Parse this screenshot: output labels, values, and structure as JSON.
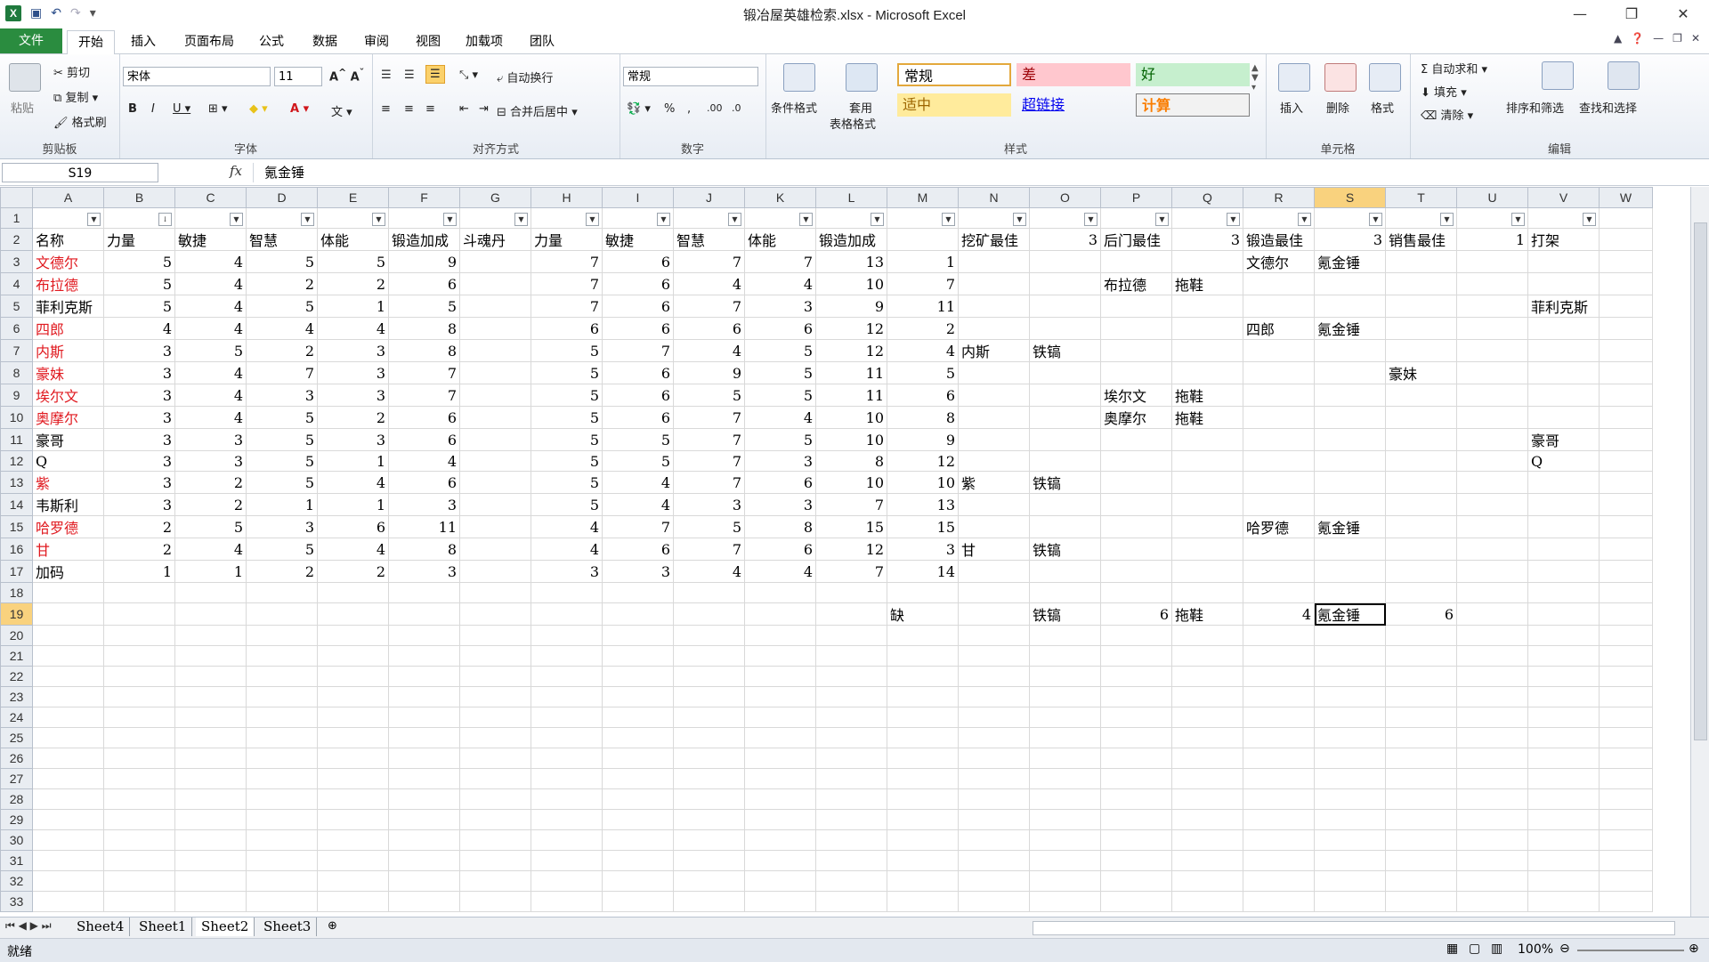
{
  "window": {
    "title": "锻冶屋英雄检索.xlsx - Microsoft Excel"
  },
  "ribbon_tabs": [
    "文件",
    "开始",
    "插入",
    "页面布局",
    "公式",
    "数据",
    "审阅",
    "视图",
    "加载项",
    "团队"
  ],
  "clipboard": {
    "paste": "粘贴",
    "cut": "剪切",
    "copy": "复制",
    "format_painter": "格式刷",
    "label": "剪贴板"
  },
  "font": {
    "name": "宋体",
    "size": "11",
    "label": "字体"
  },
  "alignment": {
    "wrap": "自动换行",
    "merge": "合并后居中",
    "label": "对齐方式"
  },
  "number": {
    "format": "常规",
    "label": "数字"
  },
  "styles": {
    "cond": "条件格式",
    "table1": "套用",
    "table2": "表格格式",
    "normal": "常规",
    "bad": "差",
    "good": "好",
    "neutral": "适中",
    "hyperlink": "超链接",
    "calc": "计算",
    "label": "样式"
  },
  "cells": {
    "insert": "插入",
    "delete": "删除",
    "format": "格式",
    "label": "单元格"
  },
  "editing": {
    "autosum": "自动求和",
    "fill": "填充",
    "clear": "清除",
    "sort": "排序和筛选",
    "find": "查找和选择",
    "label": "编辑"
  },
  "formula_bar": {
    "name_box": "S19",
    "content": "氪金锤"
  },
  "columns": [
    "A",
    "B",
    "C",
    "D",
    "E",
    "F",
    "G",
    "H",
    "I",
    "J",
    "K",
    "L",
    "M",
    "N",
    "O",
    "P",
    "Q",
    "R",
    "S",
    "T",
    "U",
    "V",
    "W"
  ],
  "filter_row_b": "↓",
  "rows": [
    {
      "n": "1",
      "c": [
        "",
        "",
        "",
        "",
        "",
        "",
        "",
        "",
        "",
        "",
        "",
        "",
        "",
        "",
        "",
        "",
        "",
        "",
        "",
        "",
        "",
        "",
        ""
      ]
    },
    {
      "n": "2",
      "c": [
        "名称",
        "力量",
        "敏捷",
        "智慧",
        "体能",
        "锻造加成",
        "斗魂丹",
        "力量",
        "敏捷",
        "智慧",
        "体能",
        "锻造加成",
        "",
        "挖矿最佳",
        "3",
        "后门最佳",
        "3",
        "锻造最佳",
        "3",
        "销售最佳",
        "1",
        "打架",
        ""
      ]
    },
    {
      "n": "3",
      "c": [
        "文德尔",
        "5",
        "4",
        "5",
        "5",
        "9",
        "",
        "7",
        "6",
        "7",
        "7",
        "13",
        "1",
        "",
        "",
        "",
        "",
        "文德尔",
        "氪金锤",
        "",
        "",
        "",
        ""
      ]
    },
    {
      "n": "4",
      "c": [
        "布拉德",
        "5",
        "4",
        "2",
        "2",
        "6",
        "",
        "7",
        "6",
        "4",
        "4",
        "10",
        "7",
        "",
        "",
        "布拉德",
        "拖鞋",
        "",
        "",
        "",
        "",
        "",
        ""
      ]
    },
    {
      "n": "5",
      "c": [
        "菲利克斯",
        "5",
        "4",
        "5",
        "1",
        "5",
        "",
        "7",
        "6",
        "7",
        "3",
        "9",
        "11",
        "",
        "",
        "",
        "",
        "",
        "",
        "",
        "",
        "菲利克斯",
        ""
      ]
    },
    {
      "n": "6",
      "c": [
        "四郎",
        "4",
        "4",
        "4",
        "4",
        "8",
        "",
        "6",
        "6",
        "6",
        "6",
        "12",
        "2",
        "",
        "",
        "",
        "",
        "四郎",
        "氪金锤",
        "",
        "",
        "",
        ""
      ]
    },
    {
      "n": "7",
      "c": [
        "内斯",
        "3",
        "5",
        "2",
        "3",
        "8",
        "",
        "5",
        "7",
        "4",
        "5",
        "12",
        "4",
        "内斯",
        "铁镐",
        "",
        "",
        "",
        "",
        "",
        "",
        "",
        ""
      ]
    },
    {
      "n": "8",
      "c": [
        "豪妹",
        "3",
        "4",
        "7",
        "3",
        "7",
        "",
        "5",
        "6",
        "9",
        "5",
        "11",
        "5",
        "",
        "",
        "",
        "",
        "",
        "",
        "豪妹",
        "",
        "",
        ""
      ]
    },
    {
      "n": "9",
      "c": [
        "埃尔文",
        "3",
        "4",
        "3",
        "3",
        "7",
        "",
        "5",
        "6",
        "5",
        "5",
        "11",
        "6",
        "",
        "",
        "埃尔文",
        "拖鞋",
        "",
        "",
        "",
        "",
        "",
        ""
      ]
    },
    {
      "n": "10",
      "c": [
        "奥摩尔",
        "3",
        "4",
        "5",
        "2",
        "6",
        "",
        "5",
        "6",
        "7",
        "4",
        "10",
        "8",
        "",
        "",
        "奥摩尔",
        "拖鞋",
        "",
        "",
        "",
        "",
        "",
        ""
      ]
    },
    {
      "n": "11",
      "c": [
        "豪哥",
        "3",
        "3",
        "5",
        "3",
        "6",
        "",
        "5",
        "5",
        "7",
        "5",
        "10",
        "9",
        "",
        "",
        "",
        "",
        "",
        "",
        "",
        "",
        "豪哥",
        ""
      ]
    },
    {
      "n": "12",
      "c": [
        "Q",
        "3",
        "3",
        "5",
        "1",
        "4",
        "",
        "5",
        "5",
        "7",
        "3",
        "8",
        "12",
        "",
        "",
        "",
        "",
        "",
        "",
        "",
        "",
        "Q",
        ""
      ]
    },
    {
      "n": "13",
      "c": [
        "紫",
        "3",
        "2",
        "5",
        "4",
        "6",
        "",
        "5",
        "4",
        "7",
        "6",
        "10",
        "10",
        "紫",
        "铁镐",
        "",
        "",
        "",
        "",
        "",
        "",
        "",
        ""
      ]
    },
    {
      "n": "14",
      "c": [
        "韦斯利",
        "3",
        "2",
        "1",
        "1",
        "3",
        "",
        "5",
        "4",
        "3",
        "3",
        "7",
        "13",
        "",
        "",
        "",
        "",
        "",
        "",
        "",
        "",
        "",
        ""
      ]
    },
    {
      "n": "15",
      "c": [
        "哈罗德",
        "2",
        "5",
        "3",
        "6",
        "11",
        "",
        "4",
        "7",
        "5",
        "8",
        "15",
        "15",
        "",
        "",
        "",
        "",
        "哈罗德",
        "氪金锤",
        "",
        "",
        "",
        ""
      ]
    },
    {
      "n": "16",
      "c": [
        "甘",
        "2",
        "4",
        "5",
        "4",
        "8",
        "",
        "4",
        "6",
        "7",
        "6",
        "12",
        "3",
        "甘",
        "铁镐",
        "",
        "",
        "",
        "",
        "",
        "",
        "",
        ""
      ]
    },
    {
      "n": "17",
      "c": [
        "加码",
        "1",
        "1",
        "2",
        "2",
        "3",
        "",
        "3",
        "3",
        "4",
        "4",
        "7",
        "14",
        "",
        "",
        "",
        "",
        "",
        "",
        "",
        "",
        "",
        ""
      ]
    },
    {
      "n": "18",
      "c": [
        "",
        "",
        "",
        "",
        "",
        "",
        "",
        "",
        "",
        "",
        "",
        "",
        "",
        "",
        "",
        "",
        "",
        "",
        "",
        "",
        "",
        "",
        ""
      ]
    },
    {
      "n": "19",
      "c": [
        "",
        "",
        "",
        "",
        "",
        "",
        "",
        "",
        "",
        "",
        "",
        "",
        "缺",
        "",
        "铁镐",
        "6",
        "拖鞋",
        "4",
        "氪金锤",
        "6",
        "",
        "",
        ""
      ]
    },
    {
      "n": "20",
      "c": []
    },
    {
      "n": "21",
      "c": []
    },
    {
      "n": "22",
      "c": []
    },
    {
      "n": "23",
      "c": []
    },
    {
      "n": "24",
      "c": []
    },
    {
      "n": "25",
      "c": []
    },
    {
      "n": "26",
      "c": []
    },
    {
      "n": "27",
      "c": []
    },
    {
      "n": "28",
      "c": []
    },
    {
      "n": "29",
      "c": []
    },
    {
      "n": "30",
      "c": []
    },
    {
      "n": "31",
      "c": []
    },
    {
      "n": "32",
      "c": []
    },
    {
      "n": "33",
      "c": []
    }
  ],
  "red_names": [
    "文德尔",
    "布拉德",
    "四郎",
    "内斯",
    "豪妹",
    "埃尔文",
    "奥摩尔",
    "紫",
    "哈罗德",
    "甘"
  ],
  "sheets": [
    "Sheet4",
    "Sheet1",
    "Sheet2",
    "Sheet3"
  ],
  "active_sheet": "Sheet2",
  "status": {
    "ready": "就绪",
    "zoom": "100%"
  },
  "colors": {
    "file_tab": "#2a8c3f",
    "selected_header": "#f9d27e",
    "red_text": "#e0191f"
  }
}
